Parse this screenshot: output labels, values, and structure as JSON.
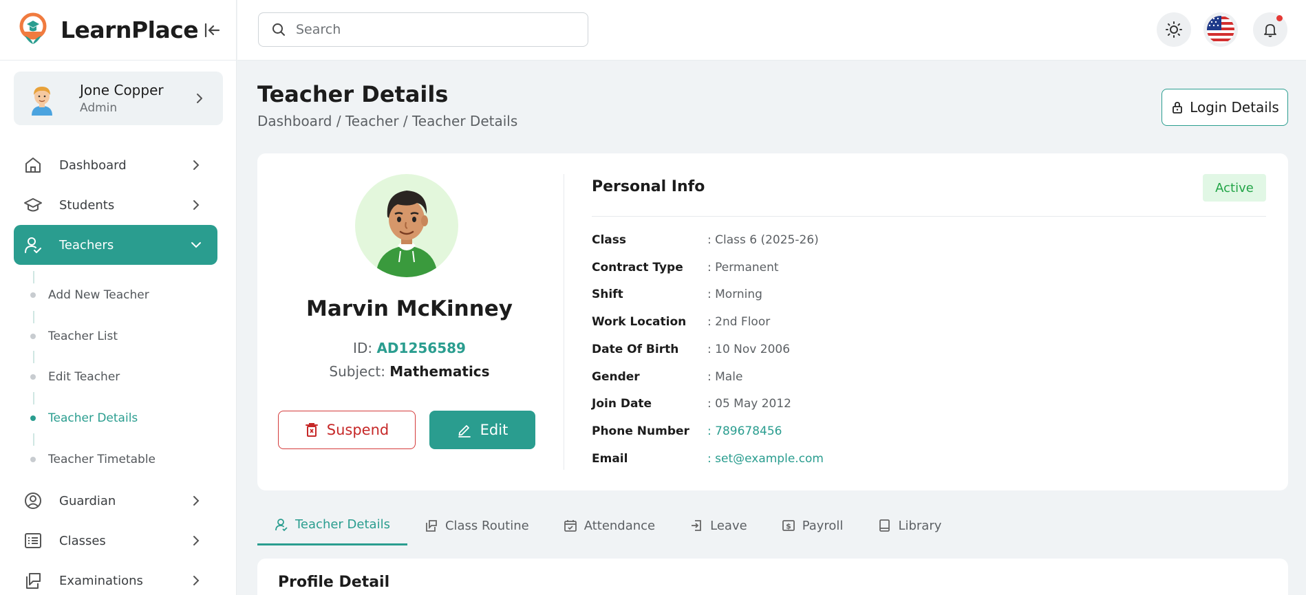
{
  "app": {
    "name": "LearnPlace"
  },
  "user": {
    "name": "Jone Copper",
    "role": "Admin"
  },
  "nav": {
    "items": [
      {
        "label": "Dashboard",
        "icon": "home-icon"
      },
      {
        "label": "Students",
        "icon": "graduation-cap-icon"
      },
      {
        "label": "Teachers",
        "icon": "teacher-icon"
      },
      {
        "label": "Guardian",
        "icon": "user-circle-icon"
      },
      {
        "label": "Classes",
        "icon": "list-icon"
      },
      {
        "label": "Examinations",
        "icon": "exam-icon"
      }
    ],
    "teacher_sub": [
      {
        "label": "Add New Teacher"
      },
      {
        "label": "Teacher List"
      },
      {
        "label": "Edit Teacher"
      },
      {
        "label": "Teacher Details"
      },
      {
        "label": "Teacher Timetable"
      }
    ]
  },
  "search": {
    "placeholder": "Search"
  },
  "page": {
    "title": "Teacher Details",
    "breadcrumb": "Dashboard / Teacher / Teacher Details",
    "login_details_label": "Login Details"
  },
  "teacher": {
    "name": "Marvin McKinney",
    "id_label": "ID:",
    "id": "AD1256589",
    "subject_label": "Subject:",
    "subject": "Mathematics",
    "suspend_label": "Suspend",
    "edit_label": "Edit"
  },
  "personal_info": {
    "title": "Personal Info",
    "status": "Active",
    "rows": [
      {
        "label": "Class",
        "value": ": Class 6 (2025-26)"
      },
      {
        "label": "Contract Type",
        "value": ": Permanent"
      },
      {
        "label": "Shift",
        "value": ": Morning"
      },
      {
        "label": "Work Location",
        "value": ": 2nd Floor"
      },
      {
        "label": "Date Of Birth",
        "value": ": 10 Nov 2006"
      },
      {
        "label": "Gender",
        "value": ": Male"
      },
      {
        "label": "Join Date",
        "value": ": 05 May 2012"
      },
      {
        "label": "Phone Number",
        "value": ": 789678456"
      },
      {
        "label": "Email",
        "value": ": set@example.com"
      }
    ]
  },
  "tabs": [
    {
      "label": "Teacher Details",
      "icon": "user-icon"
    },
    {
      "label": "Class Routine",
      "icon": "edit-note-icon"
    },
    {
      "label": "Attendance",
      "icon": "calendar-check-icon"
    },
    {
      "label": "Leave",
      "icon": "exit-icon"
    },
    {
      "label": "Payroll",
      "icon": "dollar-icon"
    },
    {
      "label": "Library",
      "icon": "book-icon"
    }
  ],
  "profile_detail": {
    "title": "Profile Detail"
  },
  "colors": {
    "accent": "#2a9d8f",
    "danger": "#c62828",
    "success": "#22a447"
  }
}
